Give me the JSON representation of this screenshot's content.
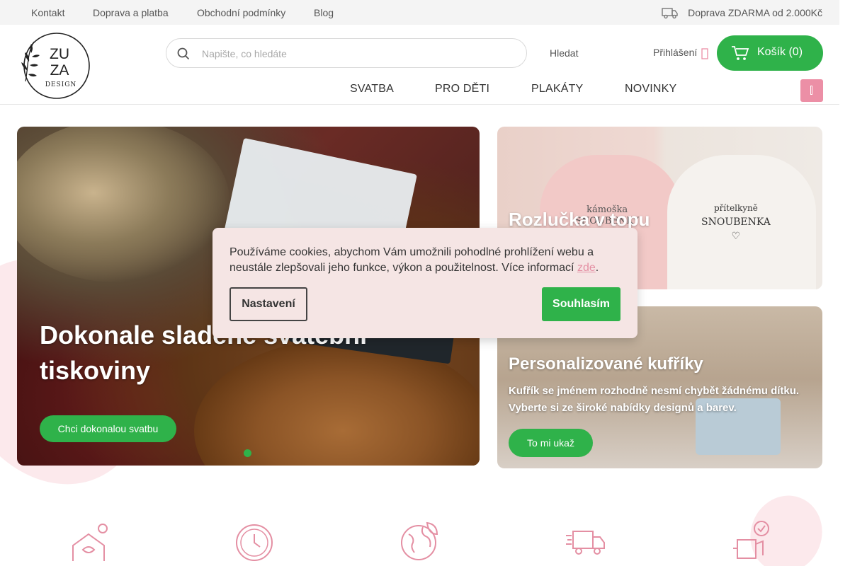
{
  "topbar": {
    "links": [
      "Kontakt",
      "Doprava a platba",
      "Obchodní podmínky",
      "Blog"
    ],
    "shipping_text": "Doprava ZDARMA od 2.000Kč",
    "icon": "truck-icon"
  },
  "header": {
    "logo_icon": "zuza-design-logo",
    "logo_text": [
      "ZU",
      "ZA",
      "DESIGN"
    ],
    "search_placeholder": "Napište, co hledáte",
    "search_value": "",
    "search_button": "Hledat",
    "login_label": "Přihlášení",
    "cart_label": "Košík (0)",
    "nav": [
      "SVATBA",
      "PRO DĚTI",
      "PLAKÁTY",
      "NOVINKY"
    ]
  },
  "hero": {
    "title": "Dokonale sladěné svatební tiskoviny",
    "button": "Chci dokonalou svatbu",
    "active_slide": 1
  },
  "tiles": {
    "top": {
      "title": "Rozlučka v topu",
      "print_left": [
        "kámoška",
        "SNOUBENKY"
      ],
      "print_right": [
        "přítelkyně",
        "SNOUBENKA",
        "♡"
      ]
    },
    "bottom": {
      "title": "Personalizované kufříky",
      "text": "Kufřík se jménem rozhodně nesmí chybět žádnému dítku. Vyberte si ze široké nabídky designů a barev.",
      "button": "To mi ukaž"
    }
  },
  "cookie": {
    "text": "Používáme cookies, abychom Vám umožnili pohodlné prohlížení webu a neustále zlepšovali jeho funkce, výkon a použitelnost. Více informací",
    "link": "zde",
    "period": ".",
    "settings_button": "Nastavení",
    "accept_button": "Souhlasím"
  },
  "features": [
    "handmade-icon",
    "clock-icon",
    "eco-globe-icon",
    "delivery-truck-icon",
    "package-check-icon"
  ],
  "colors": {
    "accent_green": "#2fb24a",
    "accent_pink": "#ec8fa6",
    "topbar_bg": "#f4f4f4",
    "cookie_bg": "#f5e5e4"
  }
}
